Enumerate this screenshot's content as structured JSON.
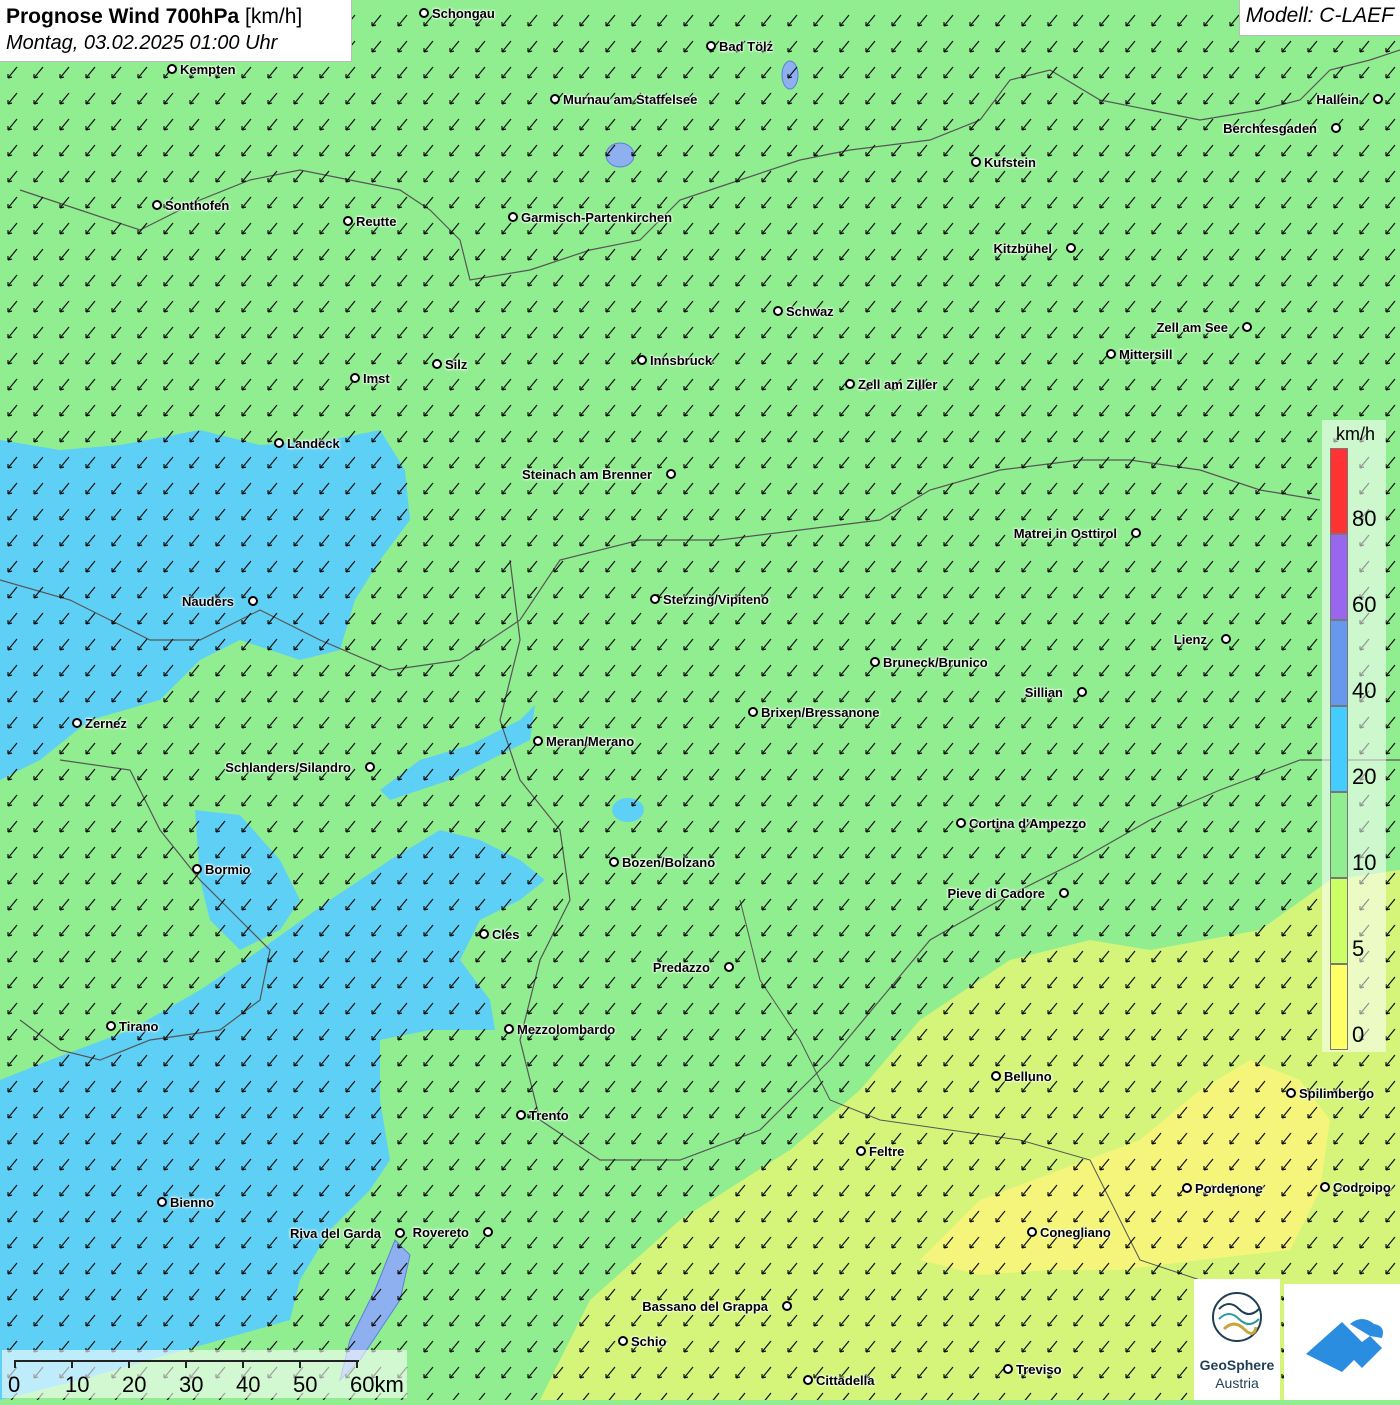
{
  "title": {
    "main": "Prognose Wind 700hPa",
    "unit": "[km/h]",
    "datetime": "Montag, 03.02.2025 01:00 Uhr"
  },
  "model": "Modell: C-LAEF",
  "legend": {
    "unit": "km/h",
    "bins": [
      {
        "from": 0,
        "to": 5,
        "color": "#ffff66"
      },
      {
        "from": 5,
        "to": 10,
        "color": "#ccff66"
      },
      {
        "from": 10,
        "to": 20,
        "color": "#90ee90"
      },
      {
        "from": 20,
        "to": 40,
        "color": "#44ccff"
      },
      {
        "from": 40,
        "to": 60,
        "color": "#6699ee"
      },
      {
        "from": 60,
        "to": 80,
        "color": "#9966ee"
      },
      {
        "from": 80,
        "to": 100,
        "color": "#ff3333"
      }
    ],
    "labels": [
      "0",
      "5",
      "10",
      "20",
      "40",
      "60",
      "80"
    ]
  },
  "scalebar": {
    "labels": [
      "0",
      "10",
      "20",
      "30",
      "40",
      "50",
      "60km"
    ]
  },
  "logo": {
    "name_line1": "GeoSphere",
    "name_line2": "Austria"
  },
  "wind": {
    "direction": "from north-east",
    "speed_zones": [
      "5-10 km/h south-east",
      "10-20 km/h central",
      "20-40 km/h west"
    ]
  },
  "cities": [
    {
      "name": "Schongau",
      "label": "right"
    },
    {
      "name": "Kempten",
      "label": "right"
    },
    {
      "name": "Bad Tölz",
      "label": "right"
    },
    {
      "name": "Murnau am Staffelsee",
      "label": "right"
    },
    {
      "name": "Hallein",
      "label": "left"
    },
    {
      "name": "Berchtesgaden",
      "label": "left"
    },
    {
      "name": "Kufstein",
      "label": "right"
    },
    {
      "name": "Sonthofen",
      "label": "right"
    },
    {
      "name": "Reutte",
      "label": "right"
    },
    {
      "name": "Garmisch-Partenkirchen",
      "label": "right"
    },
    {
      "name": "Kitzbühel",
      "label": "left"
    },
    {
      "name": "Schwaz",
      "label": "right"
    },
    {
      "name": "Zell am See",
      "label": "left"
    },
    {
      "name": "Mittersill",
      "label": "right"
    },
    {
      "name": "Innsbruck",
      "label": "right"
    },
    {
      "name": "Silz",
      "label": "right"
    },
    {
      "name": "Imst",
      "label": "right"
    },
    {
      "name": "Zell am Ziller",
      "label": "right"
    },
    {
      "name": "Landeck",
      "label": "right"
    },
    {
      "name": "Steinach am Brenner",
      "label": "left"
    },
    {
      "name": "Matrei in Osttirol",
      "label": "left"
    },
    {
      "name": "Nauders",
      "label": "left"
    },
    {
      "name": "Sterzing/Vipiteno",
      "label": "right"
    },
    {
      "name": "Lienz",
      "label": "left"
    },
    {
      "name": "Bruneck/Brunico",
      "label": "right"
    },
    {
      "name": "Sillian",
      "label": "left"
    },
    {
      "name": "Zernez",
      "label": "right"
    },
    {
      "name": "Brixen/Bressanone",
      "label": "right"
    },
    {
      "name": "Meran/Merano",
      "label": "right"
    },
    {
      "name": "Schlanders/Silandro",
      "label": "left"
    },
    {
      "name": "Cortina d'Ampezzo",
      "label": "right"
    },
    {
      "name": "Bozen/Bolzano",
      "label": "right"
    },
    {
      "name": "Bormio",
      "label": "right"
    },
    {
      "name": "Pieve di Cadore",
      "label": "left"
    },
    {
      "name": "Cles",
      "label": "right"
    },
    {
      "name": "Predazzo",
      "label": "left"
    },
    {
      "name": "Tirano",
      "label": "right"
    },
    {
      "name": "Mezzolombardo",
      "label": "right"
    },
    {
      "name": "Belluno",
      "label": "right"
    },
    {
      "name": "Spilimbergo",
      "label": "right"
    },
    {
      "name": "Trento",
      "label": "right"
    },
    {
      "name": "Feltre",
      "label": "right"
    },
    {
      "name": "Pordenone",
      "label": "right"
    },
    {
      "name": "Codroipo",
      "label": "right"
    },
    {
      "name": "Bienno",
      "label": "right"
    },
    {
      "name": "Riva del Garda",
      "label": "left"
    },
    {
      "name": "Rovereto",
      "label": "left"
    },
    {
      "name": "Conegliano",
      "label": "right"
    },
    {
      "name": "Bassano del Grappa",
      "label": "left"
    },
    {
      "name": "Schio",
      "label": "right"
    },
    {
      "name": "Treviso",
      "label": "right"
    },
    {
      "name": "Cittadella",
      "label": "right"
    }
  ]
}
